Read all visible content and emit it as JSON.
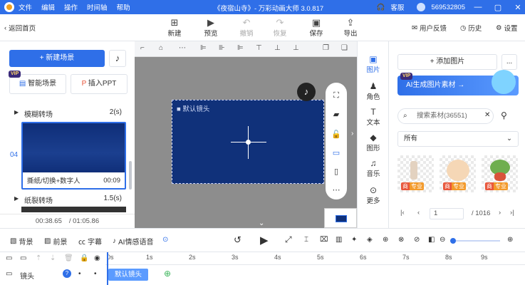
{
  "app": {
    "menus": [
      "文件",
      "编辑",
      "操作",
      "时间轴",
      "帮助"
    ],
    "title": "《夜宿山寺》- 万彩动画大师 3.0.817",
    "service": "客服",
    "user_id": "569532805"
  },
  "toolbar": {
    "back": "返回首页",
    "new": "新建",
    "preview": "预览",
    "undo": "撤销",
    "redo": "恢复",
    "save": "保存",
    "export": "导出",
    "feedback": "用户反馈",
    "history": "历史",
    "settings": "设置"
  },
  "left": {
    "new_scene": "+ 新建场景",
    "smart_scene": "智能场景",
    "insert_ppt": "插入PPT",
    "vip": "VIP",
    "scene1_transition": "模糊转场",
    "scene1_duration": "2(s)",
    "scene_index": "04",
    "scene_caption": "撕纸/切换+数字人",
    "scene_time": "00:09",
    "scene2_transition": "纸裂转场",
    "scene2_duration": "1.5(s)",
    "current_time": "00:38.65",
    "total_time": "/ 01:05.86"
  },
  "stage": {
    "camera_label": "默认镜头"
  },
  "right_tabs": [
    "图片",
    "角色",
    "文本",
    "图形",
    "音乐",
    "更多"
  ],
  "assets": {
    "add_image": "+ 添加图片",
    "more": "...",
    "ai_banner": "AI生成图片素材 →",
    "search_placeholder": "搜索素材(36551)",
    "filter_all": "所有",
    "badge_left": "商",
    "badge_right": "专业",
    "page_current": "1",
    "page_total": "/ 1016"
  },
  "controls": {
    "background": "背景",
    "foreground": "前景",
    "subtitle": "字幕",
    "ai_voice": "AI情感语音"
  },
  "timeline": {
    "ticks": [
      "0s",
      "1s",
      "2s",
      "3s",
      "4s",
      "5s",
      "6s",
      "7s",
      "8s",
      "9s"
    ],
    "track_label": "镜头",
    "clip_label": "默认镜头"
  },
  "colors": {
    "brand": "#2f6fe8",
    "canvas": "#10317a"
  }
}
